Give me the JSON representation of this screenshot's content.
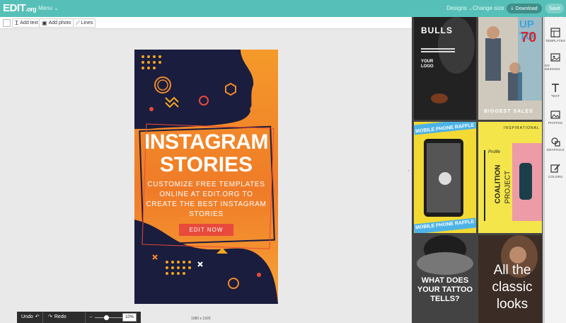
{
  "header": {
    "logo_text": "EDIT",
    "logo_suffix": ".org",
    "menu_label": "Menu",
    "designs_label": "Designs",
    "change_size_label": "Change size",
    "download_label": "Download",
    "save_label": "Save"
  },
  "toolbar": {
    "add_text": "Add text",
    "add_photo": "Add photo",
    "lines": "Lines"
  },
  "design": {
    "title_line1": "INSTAGRAM",
    "title_line2": "STORIES",
    "subtitle_line1": "CUSTOMIZE FREE TEMPLATES",
    "subtitle_line2": "ONLINE AT EDIT.ORG TO",
    "subtitle_line3": "CREATE THE BEST INSTAGRAM",
    "subtitle_line4": "STORIES",
    "cta": "EDIT NOW",
    "dimensions": "1080 x 1920"
  },
  "bottombar": {
    "undo": "Undo",
    "redo": "Redo",
    "zoom_value": "10%"
  },
  "colors": {
    "header": "#56c0b8",
    "accent_dark": "#3e8f89",
    "design_navy": "#1a1d3d",
    "design_orange": "#f28a2a",
    "cta_red": "#e84a3b"
  },
  "templates": [
    {
      "title": "BULLS",
      "label": "YOUR LOGO"
    },
    {
      "title": "UP TO",
      "big": "70",
      "footer": "BIGGEST SALES"
    },
    {
      "banner": "MOBILE PHONE RAFFLE",
      "banner2": "MOBILE PHONE RAFFLE"
    },
    {
      "t1": "INSPIRATIONAL",
      "t2": "Prolife",
      "t3": "COALITION",
      "t4": "PROJECT"
    },
    {
      "t1": "WHAT DOES",
      "t2": "YOUR TATTOO",
      "t3": "TELLS?"
    },
    {
      "t1": "All the",
      "t2": "classic",
      "t3": "looks"
    }
  ],
  "sidebar": {
    "items": [
      {
        "label": "TEMPLATES",
        "icon": "templates-icon"
      },
      {
        "label": "MY DESIGNS",
        "icon": "my-designs-icon"
      },
      {
        "label": "TEXT",
        "icon": "text-icon"
      },
      {
        "label": "PHOTOS",
        "icon": "photos-icon"
      },
      {
        "label": "GRAPHICS",
        "icon": "graphics-icon"
      },
      {
        "label": "COLORS",
        "icon": "colors-icon"
      }
    ]
  }
}
